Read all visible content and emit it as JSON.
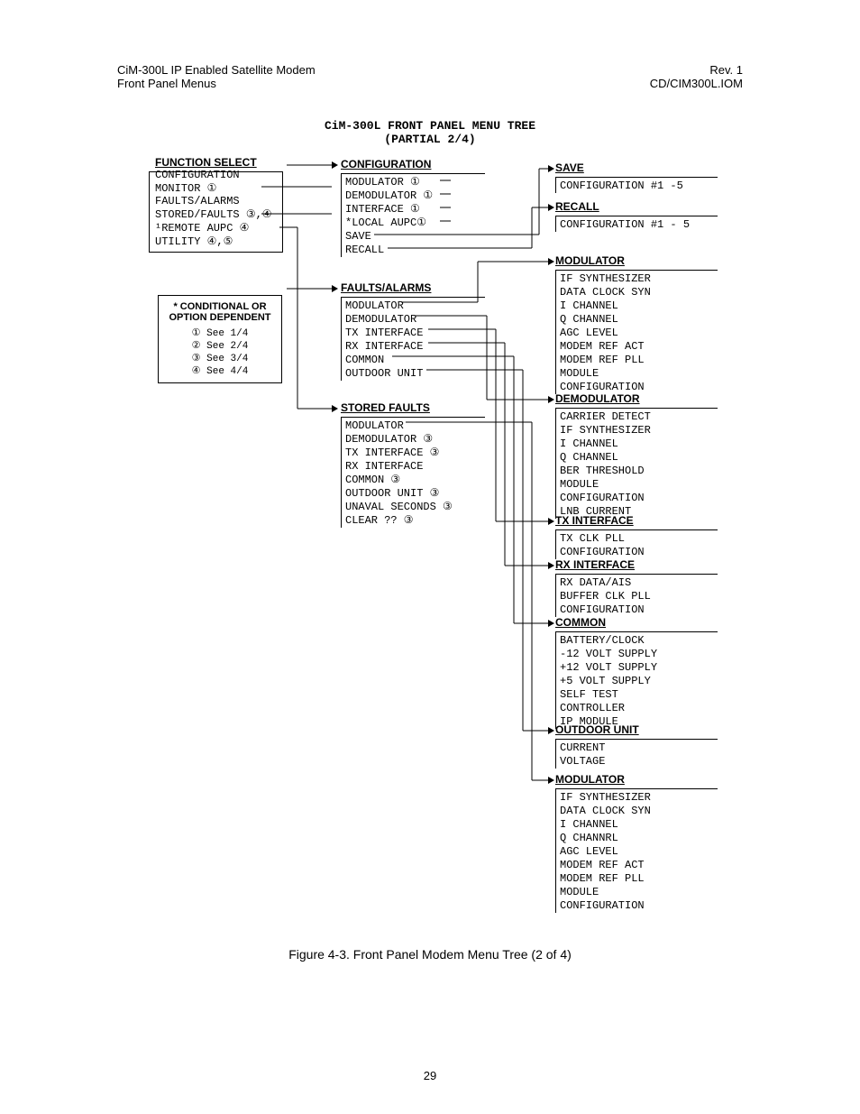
{
  "header": {
    "left1": "CiM-300L IP Enabled Satellite Modem",
    "left2": "Front Panel Menus",
    "right1": "Rev. 1",
    "right2": "CD/CIM300L.IOM"
  },
  "title": "CiM-300L FRONT PANEL MENU TREE\n(PARTIAL 2/4)",
  "function_select": {
    "hd": "FUNCTION SELECT",
    "items": [
      "CONFIGURATION",
      "MONITOR ①",
      "FAULTS/ALARMS",
      "STORED/FAULTS ③,④",
      "¹REMOTE AUPC ④",
      "UTILITY ④,⑤"
    ]
  },
  "legend": {
    "hd": "* CONDITIONAL OR\nOPTION DEPENDENT",
    "items": [
      "① See 1/4",
      "② See 2/4",
      "③ See 3/4",
      "④ See 4/4"
    ]
  },
  "configuration": {
    "hd": "CONFIGURATION",
    "items": [
      "MODULATOR ①",
      "DEMODULATOR ①",
      "INTERFACE ①",
      "*LOCAL AUPC①",
      "SAVE",
      "RECALL"
    ]
  },
  "faults_alarms": {
    "hd": "FAULTS/ALARMS",
    "items": [
      "MODULATOR",
      "DEMODULATOR",
      "TX INTERFACE",
      "RX INTERFACE",
      "COMMON",
      "OUTDOOR UNIT"
    ]
  },
  "stored_faults": {
    "hd": "STORED FAULTS",
    "items": [
      "MODULATOR",
      "DEMODULATOR ③",
      "TX INTERFACE ③",
      "RX INTERFACE",
      "COMMON ③",
      "OUTDOOR UNIT ③",
      "UNAVAL SECONDS ③",
      "CLEAR ?? ③"
    ]
  },
  "save": {
    "hd": "SAVE",
    "items": [
      "CONFIGURATION #1 -5"
    ]
  },
  "recall": {
    "hd": "RECALL",
    "items": [
      "CONFIGURATION #1 - 5"
    ]
  },
  "modulator1": {
    "hd": "MODULATOR",
    "items": [
      "IF SYNTHESIZER",
      "DATA CLOCK SYN",
      "I CHANNEL",
      "Q CHANNEL",
      "AGC LEVEL",
      "MODEM REF ACT",
      "MODEM REF PLL",
      "MODULE",
      "CONFIGURATION"
    ]
  },
  "demodulator": {
    "hd": "DEMODULATOR",
    "items": [
      "CARRIER DETECT",
      "IF SYNTHESIZER",
      "I CHANNEL",
      "Q CHANNEL",
      "BER THRESHOLD",
      "MODULE",
      "CONFIGURATION",
      "LNB CURRENT"
    ]
  },
  "txinterface": {
    "hd": "TX INTERFACE",
    "items": [
      "TX CLK PLL",
      "CONFIGURATION"
    ]
  },
  "rxinterface": {
    "hd": "RX INTERFACE",
    "items": [
      "RX DATA/AIS",
      "BUFFER CLK PLL",
      "CONFIGURATION"
    ]
  },
  "common": {
    "hd": "COMMON",
    "items": [
      "BATTERY/CLOCK",
      "-12 VOLT SUPPLY",
      "+12 VOLT SUPPLY",
      "+5 VOLT SUPPLY",
      "SELF TEST",
      "CONTROLLER",
      "IP MODULE"
    ]
  },
  "outdoorunit": {
    "hd": "OUTDOOR UNIT",
    "items": [
      "CURRENT",
      "VOLTAGE"
    ]
  },
  "modulator2": {
    "hd": "MODULATOR",
    "items": [
      "IF SYNTHESIZER",
      "DATA CLOCK SYN",
      "I CHANNEL",
      "Q CHANNRL",
      "AGC LEVEL",
      "MODEM REF ACT",
      "MODEM REF PLL",
      "MODULE",
      "CONFIGURATION"
    ]
  },
  "caption": "Figure 4-3.  Front Panel Modem Menu Tree (2 of 4)",
  "pagenum": "29"
}
